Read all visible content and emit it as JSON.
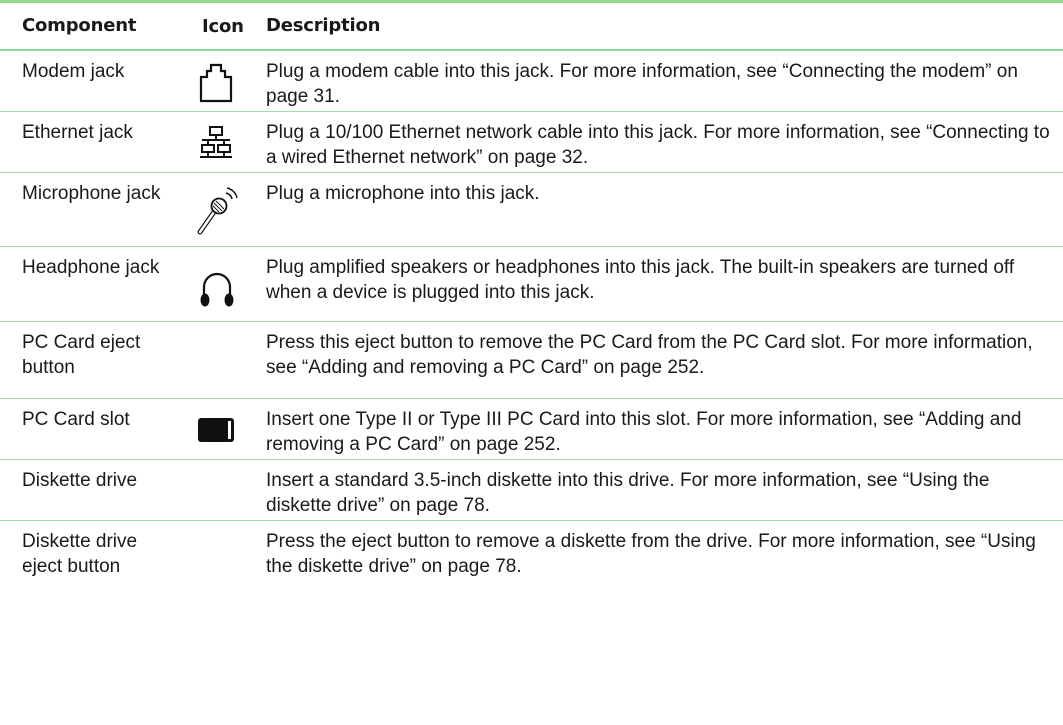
{
  "table": {
    "headers": {
      "component": "Component",
      "icon": "Icon",
      "description": "Description"
    },
    "rows": [
      {
        "component": "Modem jack",
        "icon": "modem-jack-icon",
        "description": "Plug a modem cable into this jack. For more information, see “Connecting the modem” on page 31."
      },
      {
        "component": "Ethernet jack",
        "icon": "ethernet-network-icon",
        "description": "Plug a 10/100 Ethernet network cable into this jack. For more information, see “Connecting to a wired Ethernet network” on page 32."
      },
      {
        "component": "Microphone jack",
        "icon": "microphone-icon",
        "description": "Plug a microphone into this jack."
      },
      {
        "component": "Headphone jack",
        "icon": "headphones-icon",
        "description": "Plug amplified speakers or headphones into this jack. The built-in speakers are turned off when a device is plugged into this jack."
      },
      {
        "component": "PC Card eject button",
        "icon": "",
        "description": "Press this eject button to remove the PC Card from the PC Card slot. For more information, see “Adding and removing a PC Card” on page 252."
      },
      {
        "component": "PC Card slot",
        "icon": "pc-card-slot-icon",
        "description": "Insert one Type II or Type III PC Card into this slot. For more information, see “Adding and removing a PC Card” on page 252."
      },
      {
        "component": "Diskette drive",
        "icon": "",
        "description": "Insert a standard 3.5-inch diskette into this drive. For more information, see “Using the diskette drive” on page 78."
      },
      {
        "component": "Diskette drive eject button",
        "icon": "",
        "description": "Press the eject button to remove a diskette from the drive. For more information, see “Using the diskette drive” on page 78."
      }
    ]
  },
  "colors": {
    "rule_green": "#8fd98f",
    "text": "#1a1a1a"
  }
}
